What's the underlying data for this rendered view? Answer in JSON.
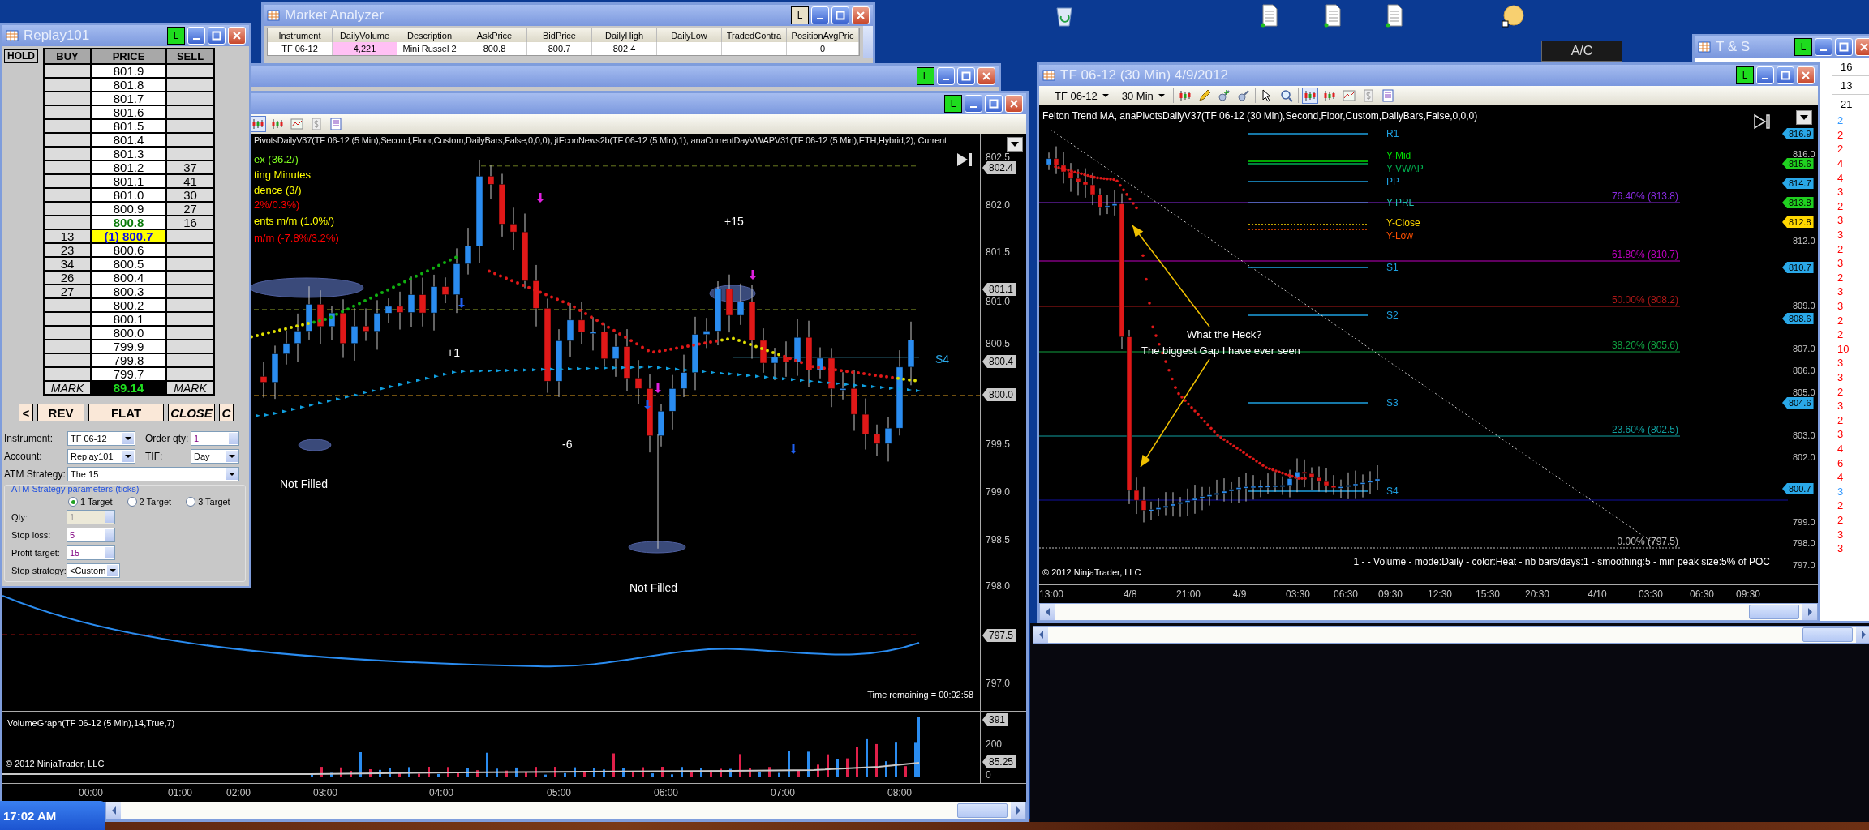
{
  "desktop": {
    "shortcut_label": "A/C"
  },
  "taskbar": {
    "clock": "17:02 AM"
  },
  "market_analyzer": {
    "title": "Market Analyzer",
    "link_button": "L",
    "columns": [
      "Instrument",
      "DailyVolume",
      "Description",
      "AskPrice",
      "BidPrice",
      "DailyHigh",
      "DailyLow",
      "TradedContra",
      "PositionAvgPric"
    ],
    "rows": [
      {
        "cells": [
          {
            "text": "TF 06-12",
            "highlighted": false
          },
          {
            "text": "4,221",
            "highlighted": true
          },
          {
            "text": "Mini Russel 2",
            "highlighted": false
          },
          {
            "text": "800.8",
            "highlighted": false
          },
          {
            "text": "800.7",
            "highlighted": false
          },
          {
            "text": "802.4",
            "highlighted": false
          },
          {
            "highlighted": false
          },
          {
            "highlighted": false
          },
          {
            "text": "0",
            "highlighted": false
          }
        ]
      }
    ]
  },
  "back_chart_window": {
    "link_button": "L"
  },
  "left_chart": {
    "link_button": "L",
    "legend": "PivotsDailyV37(TF 06-12 (5 Min),Second,Floor,Custom,DailyBars,False,0,0,0), jtEconNews2b(TF 06-12 (5 Min),1), anaCurrentDayVWAPV31(TF 06-12 (5 Min),ETH,Hybrid,2), Current",
    "indicator_lines": [
      {
        "text": "ex (36.2/)",
        "color": "#80ff20"
      },
      {
        "text": "ting Minutes",
        "color": "#ffff00"
      },
      {
        "text": "dence (3/)",
        "color": "#ffff00"
      },
      {
        "text": "2%/0.3%)",
        "color": "#ff0000"
      },
      {
        "text": "ents m/m (1.0%/)",
        "color": "#ffff00"
      },
      {
        "text": "m/m (-7.8%/3.2%)",
        "color": "#ff0000"
      }
    ],
    "annotations": [
      "+15",
      "+1",
      "-6",
      "Not Filled",
      "Not Filled",
      "S4"
    ],
    "price_axis": [
      "802.5",
      "802.0",
      "801.5",
      "801.0",
      "800.5",
      "799.5",
      "799.0",
      "798.5",
      "798.0",
      "797.0"
    ],
    "price_tags": [
      "802.4",
      "801.1",
      "800.4",
      "800.0",
      "797.5"
    ],
    "time_remaining": "Time remaining = 00:02:58",
    "volume_panel": {
      "legend": "VolumeGraph(TF 06-12 (5 Min),14,True,7)",
      "axis": [
        "200",
        "0"
      ],
      "tags": [
        "391",
        "85.25"
      ],
      "copyright": "© 2012 NinjaTrader, LLC"
    },
    "time_axis": [
      "00:00",
      "01:00",
      "02:00",
      "03:00",
      "04:00",
      "05:00",
      "06:00",
      "07:00",
      "08:00"
    ]
  },
  "replay_window": {
    "title": "Replay101",
    "link_button": "L",
    "hold_button": "HOLD",
    "columns": [
      "BUY",
      "PRICE",
      "SELL"
    ],
    "rows": [
      {
        "price": "801.9",
        "kind": "normal"
      },
      {
        "price": "801.8",
        "kind": "normal"
      },
      {
        "price": "801.7",
        "kind": "normal"
      },
      {
        "price": "801.6",
        "kind": "normal"
      },
      {
        "price": "801.5",
        "kind": "normal"
      },
      {
        "price": "801.4",
        "kind": "normal"
      },
      {
        "price": "801.3",
        "kind": "normal"
      },
      {
        "price": "801.2",
        "sell": "37",
        "kind": "normal"
      },
      {
        "price": "801.1",
        "sell": "41",
        "kind": "normal"
      },
      {
        "price": "801.0",
        "sell": "30",
        "kind": "normal"
      },
      {
        "price": "800.9",
        "sell": "27",
        "kind": "normal"
      },
      {
        "price": "800.8",
        "sell": "16",
        "kind": "ask"
      },
      {
        "price": "(1) 800.7",
        "buy": "13",
        "kind": "position"
      },
      {
        "price": "800.6",
        "buy": "23",
        "kind": "normal"
      },
      {
        "price": "800.5",
        "buy": "34",
        "kind": "normal"
      },
      {
        "price": "800.4",
        "buy": "26",
        "kind": "normal"
      },
      {
        "price": "800.3",
        "buy": "27",
        "kind": "normal"
      },
      {
        "price": "800.2",
        "kind": "normal"
      },
      {
        "price": "800.1",
        "kind": "normal"
      },
      {
        "price": "800.0",
        "kind": "normal"
      },
      {
        "price": "799.9",
        "kind": "normal"
      },
      {
        "price": "799.8",
        "kind": "normal"
      },
      {
        "price": "799.7",
        "kind": "normal"
      }
    ],
    "mark_row": {
      "left": "MARK",
      "value": "89.14",
      "right": "MARK"
    },
    "buttons": [
      "<",
      "REV",
      "FLAT",
      "CLOSE",
      "C"
    ],
    "form": {
      "instrument": {
        "label": "Instrument:",
        "value": "TF 06-12"
      },
      "order_qty": {
        "label": "Order qty:",
        "value": "1"
      },
      "account": {
        "label": "Account:",
        "value": "Replay101"
      },
      "tif": {
        "label": "TIF:",
        "value": "Day"
      },
      "atm_strategy": {
        "label": "ATM Strategy:",
        "value": "The 15"
      },
      "atm_params": {
        "title": "ATM Strategy parameters (ticks)",
        "targets": [
          {
            "label": "1 Target",
            "selected": true
          },
          {
            "label": "2 Target",
            "selected": false
          },
          {
            "label": "3 Target",
            "selected": false
          }
        ],
        "fields": [
          {
            "label": "Qty:",
            "value": "1",
            "disabled": true
          },
          {
            "label": "Stop loss:",
            "value": "5",
            "disabled": false
          },
          {
            "label": "Profit target:",
            "value": "15",
            "disabled": false
          }
        ],
        "stop_strategy": {
          "label": "Stop strategy:",
          "value": "<Custom"
        }
      }
    }
  },
  "right_chart": {
    "title": "TF 06-12 (30 Min)  4/9/2012",
    "link_button": "L",
    "instrument": "TF 06-12",
    "interval": "30 Min",
    "legend": "Felton Trend MA, anaPivotsDailyV37(TF 06-12 (30 Min),Second,Floor,Custom,DailyBars,False,0,0,0)",
    "pivots": [
      {
        "text": "R1",
        "color": "#1ea0e0"
      },
      {
        "text": "Y-Mid",
        "color": "#00e000"
      },
      {
        "text": "Y-VWAP",
        "color": "#00b050"
      },
      {
        "text": "PP",
        "color": "#1ea0e0"
      },
      {
        "text": "Y-PRL",
        "color": "#20c0b0"
      },
      {
        "text": "Y-Close",
        "color": "#ffd700"
      },
      {
        "text": "Y-Low",
        "color": "#ff5000"
      },
      {
        "text": "S1",
        "color": "#1ea0e0"
      },
      {
        "text": "S2",
        "color": "#1ea0e0"
      },
      {
        "text": "S3",
        "color": "#1ea0e0"
      },
      {
        "text": "S4",
        "color": "#1ea0e0"
      }
    ],
    "fib_levels": [
      {
        "text": "76.40% (813.8)",
        "color": "#8a2be2"
      },
      {
        "text": "61.80% (810.7)",
        "color": "#c000c0"
      },
      {
        "text": "50.00% (808.2)",
        "color": "#b01818"
      },
      {
        "text": "38.20% (805.6)",
        "color": "#10a040"
      },
      {
        "text": "23.60% (802.5)",
        "color": "#10a0a0"
      },
      {
        "text": "0.00% (797.5)",
        "color": "#c0c0c0"
      }
    ],
    "annotation": [
      "What the Heck?",
      "The biggest Gap I have ever seen"
    ],
    "price_axis": [
      "816.0",
      "812.0",
      "809.0",
      "807.0",
      "806.0",
      "805.0",
      "803.0",
      "802.0",
      "799.0",
      "798.0",
      "797.0"
    ],
    "price_tags": [
      {
        "text": "816.9",
        "color": "#2aa8e8"
      },
      {
        "text": "815.6",
        "color": "#20d020"
      },
      {
        "text": "814.7",
        "color": "#2aa8e8"
      },
      {
        "text": "813.8",
        "color": "#20d020"
      },
      {
        "text": "812.8",
        "color": "#ffd700"
      },
      {
        "text": "810.7",
        "color": "#2aa8e8"
      },
      {
        "text": "808.6",
        "color": "#2aa8e8"
      },
      {
        "text": "804.6",
        "color": "#2aa8e8"
      },
      {
        "text": "800.7",
        "color": "#2aa8e8"
      }
    ],
    "volume_profile_info": "1 -  - Volume - mode:Daily  - color:Heat - nb bars/days:1 - smoothing:5 - min peak size:5% of POC",
    "copyright": "© 2012 NinjaTrader, LLC",
    "time_axis": [
      "13:00",
      "4/8",
      "21:00",
      "4/9",
      "03:30",
      "06:30",
      "09:30",
      "12:30",
      "15:30",
      "20:30",
      "4/10",
      "03:30",
      "06:30",
      "09:30"
    ]
  },
  "time_and_sales": {
    "title": "T & S",
    "link_button": "L",
    "rows": [
      "16",
      "13",
      "21"
    ],
    "sizes": [
      {
        "text": "2",
        "color": "#3399ff"
      },
      {
        "text": "2",
        "color": "#ff0000"
      },
      {
        "text": "2",
        "color": "#ff0000"
      },
      {
        "text": "4",
        "color": "#ff0000"
      },
      {
        "text": "4",
        "color": "#ff0000"
      },
      {
        "text": "3",
        "color": "#ff0000"
      },
      {
        "text": "2",
        "color": "#ff0000"
      },
      {
        "text": "3",
        "color": "#ff0000"
      },
      {
        "text": "3",
        "color": "#ff0000"
      },
      {
        "text": "2",
        "color": "#ff0000"
      },
      {
        "text": "3",
        "color": "#ff0000"
      },
      {
        "text": "2",
        "color": "#ff0000"
      },
      {
        "text": "3",
        "color": "#ff0000"
      },
      {
        "text": "3",
        "color": "#ff0000"
      },
      {
        "text": "2",
        "color": "#ff0000"
      },
      {
        "text": "2",
        "color": "#ff0000"
      },
      {
        "text": "10",
        "color": "#ff0000"
      },
      {
        "text": "3",
        "color": "#ff0000"
      },
      {
        "text": "3",
        "color": "#ff0000"
      },
      {
        "text": "2",
        "color": "#ff0000"
      },
      {
        "text": "3",
        "color": "#ff0000"
      },
      {
        "text": "2",
        "color": "#ff0000"
      },
      {
        "text": "3",
        "color": "#ff0000"
      },
      {
        "text": "4",
        "color": "#ff0000"
      },
      {
        "text": "6",
        "color": "#ff0000"
      },
      {
        "text": "4",
        "color": "#ff0000"
      },
      {
        "text": "3",
        "color": "#3399ff"
      },
      {
        "text": "2",
        "color": "#ff0000"
      },
      {
        "text": "2",
        "color": "#ff0000"
      },
      {
        "text": "3",
        "color": "#ff0000"
      },
      {
        "text": "3",
        "color": "#ff0000"
      }
    ]
  }
}
